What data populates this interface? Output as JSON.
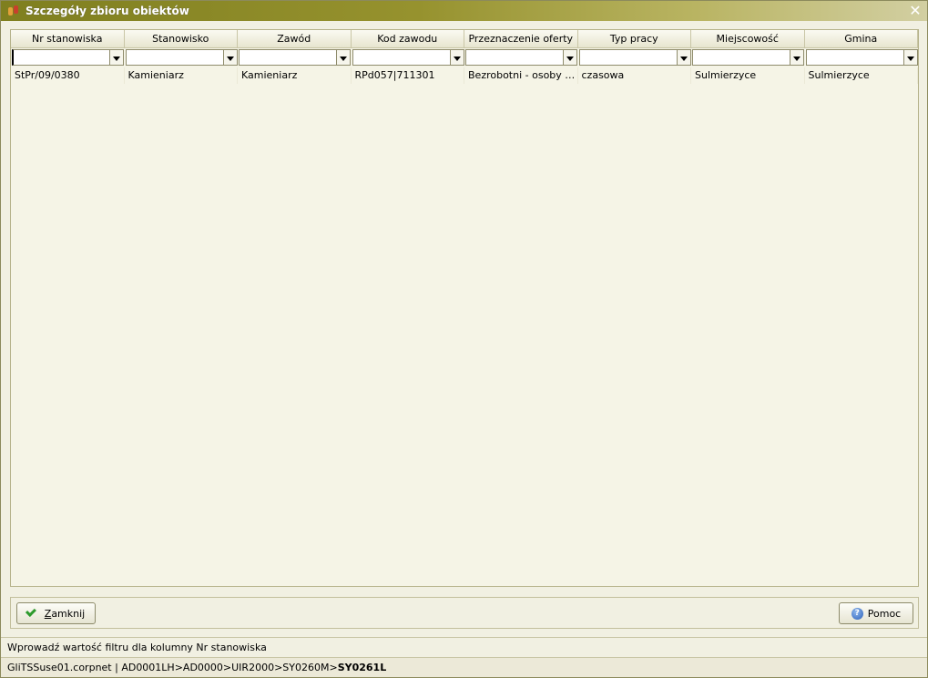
{
  "window": {
    "title": "Szczegóły zbioru obiektów",
    "close_label": "✕"
  },
  "grid": {
    "columns": [
      "Nr stanowiska",
      "Stanowisko",
      "Zawód",
      "Kod zawodu",
      "Przeznaczenie oferty",
      "Typ pracy",
      "Miejscowość",
      "Gmina"
    ],
    "filters": [
      "",
      "",
      "",
      "",
      "",
      "",
      "",
      ""
    ],
    "rows": [
      [
        "StPr/09/0380",
        "Kamieniarz",
        "Kamieniarz",
        "RPd057|711301",
        "Bezrobotni - osoby w …",
        "czasowa",
        "Sulmierzyce",
        "Sulmierzyce"
      ]
    ]
  },
  "buttons": {
    "close_label": "Zamknij",
    "help_label": "Pomoc"
  },
  "status": {
    "hint": "Wprowadź wartość filtru dla kolumny Nr stanowiska",
    "path_prefix": "GliTSSuse01.corpnet | AD0001LH>AD0000>UIR2000>SY0260M>",
    "path_current": "SY0261L"
  },
  "colors": {
    "titlebar_start": "#7f7f1f",
    "titlebar_end": "#d2cfa2",
    "panel_bg": "#f5f4e6"
  },
  "icons": {
    "title": "app-icon",
    "close": "close-icon",
    "filter_dropdown": "chevron-down-icon",
    "ok": "check-icon",
    "help": "help-icon"
  }
}
